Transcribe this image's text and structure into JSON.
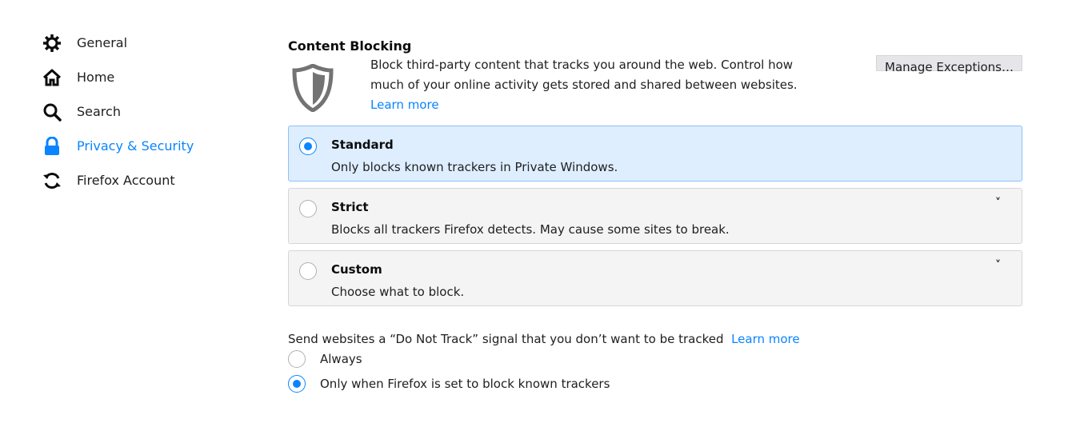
{
  "sidebar": {
    "items": [
      {
        "label": "General",
        "icon": "gear-icon",
        "selected": false
      },
      {
        "label": "Home",
        "icon": "home-icon",
        "selected": false
      },
      {
        "label": "Search",
        "icon": "search-icon",
        "selected": false
      },
      {
        "label": "Privacy & Security",
        "icon": "lock-icon",
        "selected": true
      },
      {
        "label": "Firefox Account",
        "icon": "sync-icon",
        "selected": false
      }
    ]
  },
  "content_blocking": {
    "title": "Content Blocking",
    "description": "Block third-party content that tracks you around the web. Control how much of your online activity gets stored and shared between websites.",
    "learn_more": "Learn more",
    "manage_exceptions": "Manage Exceptions…",
    "options": [
      {
        "title": "Standard",
        "description": "Only blocks known trackers in Private Windows.",
        "selected": true
      },
      {
        "title": "Strict",
        "description": "Blocks all trackers Firefox detects. May cause some sites to break.",
        "selected": false,
        "chevron": "˅"
      },
      {
        "title": "Custom",
        "description": "Choose what to block.",
        "selected": false,
        "chevron": "˅"
      }
    ]
  },
  "dnt": {
    "label": "Send websites a “Do Not Track” signal that you don’t want to be tracked",
    "learn_more": "Learn more",
    "options": [
      {
        "label": "Always",
        "selected": false
      },
      {
        "label": "Only when Firefox is set to block known trackers",
        "selected": true
      }
    ]
  },
  "colors": {
    "accent": "#0a84ff",
    "selected_bg": "#deeeff"
  }
}
